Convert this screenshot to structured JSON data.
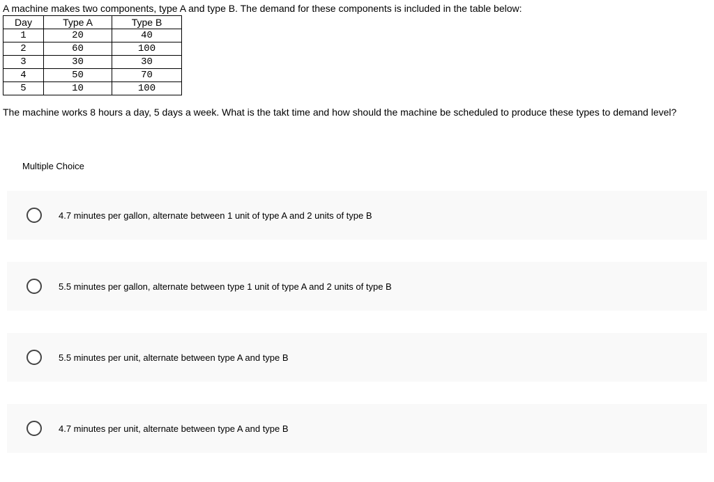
{
  "question_intro": "A machine makes two components, type A and type B. The demand for these components is included in the table below:",
  "table": {
    "headers": {
      "day": "Day",
      "type_a": "Type A",
      "type_b": "Type B"
    },
    "rows": [
      {
        "day": "1",
        "type_a": "20",
        "type_b": "40"
      },
      {
        "day": "2",
        "type_a": "60",
        "type_b": "100"
      },
      {
        "day": "3",
        "type_a": "30",
        "type_b": "30"
      },
      {
        "day": "4",
        "type_a": "50",
        "type_b": "70"
      },
      {
        "day": "5",
        "type_a": "10",
        "type_b": "100"
      }
    ]
  },
  "question_followup": "The machine works 8 hours a day, 5 days a week. What is the takt time and how should the machine be scheduled to produce these types to demand level?",
  "mc_label": "Multiple Choice",
  "choices": [
    "4.7 minutes per gallon, alternate between 1 unit of type A and 2 units of type B",
    "5.5 minutes per gallon, alternate between type 1 unit of type A and 2 units of type B",
    "5.5 minutes per unit, alternate between type A and type B",
    "4.7 minutes per unit, alternate between type A and type B"
  ]
}
